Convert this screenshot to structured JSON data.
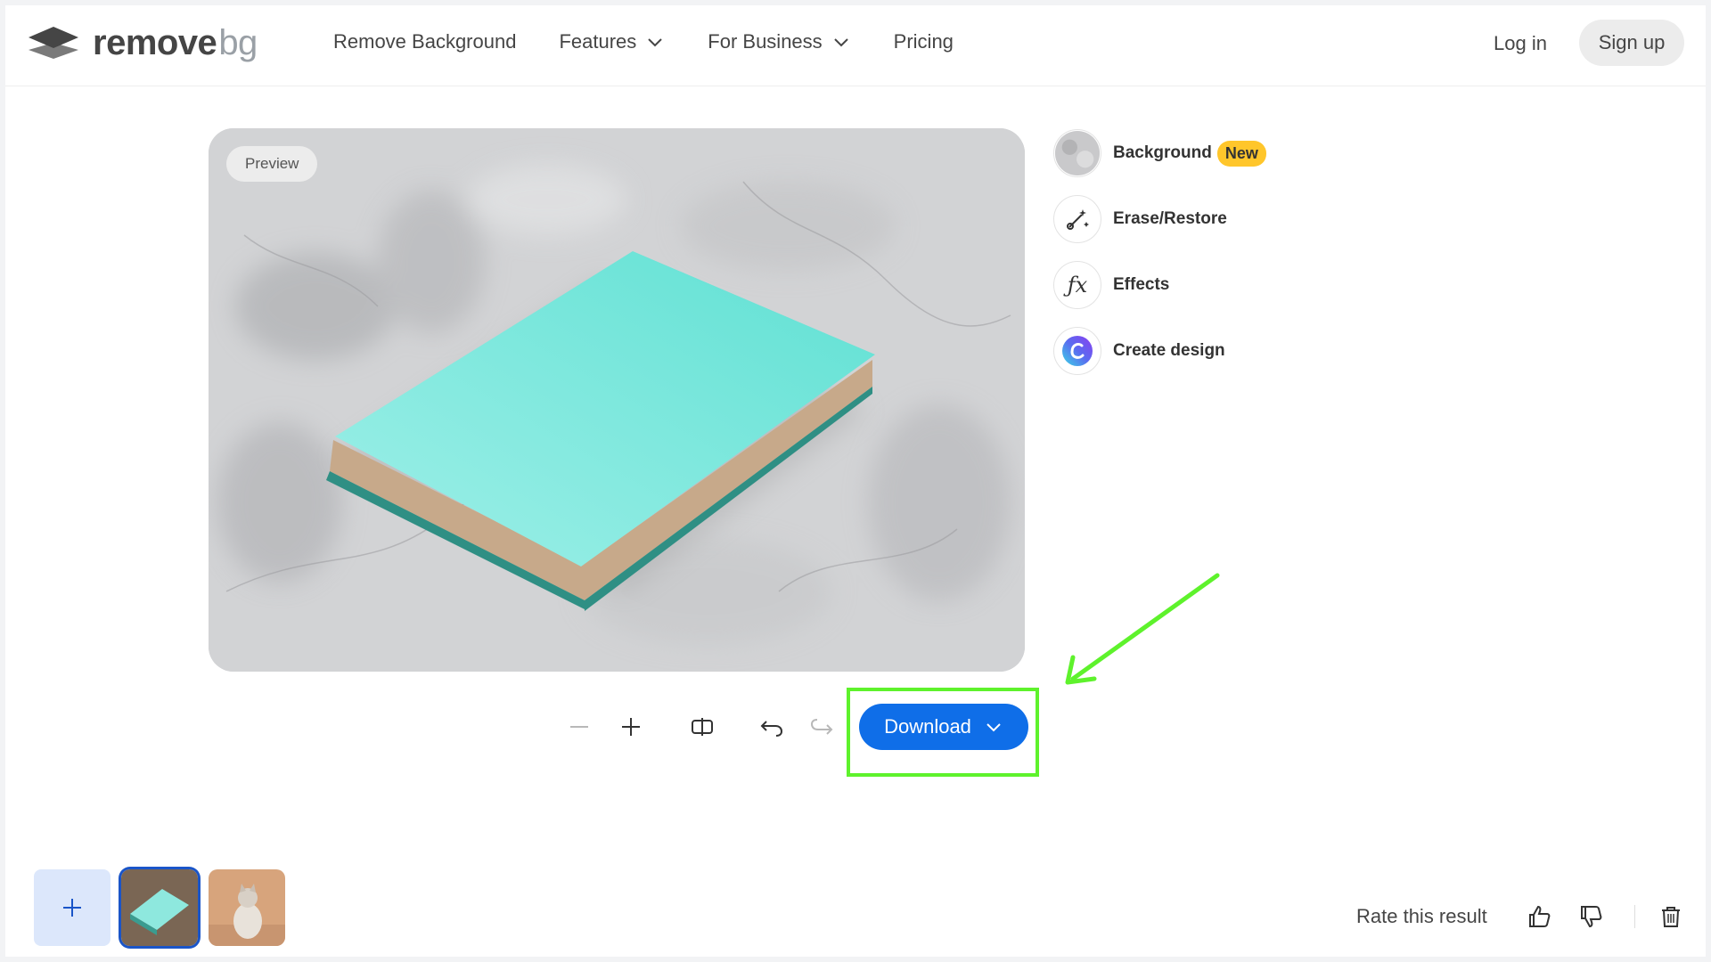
{
  "header": {
    "logo_word": "remove",
    "logo_suffix": "bg",
    "nav": [
      {
        "label": "Remove Background",
        "has_dropdown": false
      },
      {
        "label": "Features",
        "has_dropdown": true
      },
      {
        "label": "For Business",
        "has_dropdown": true
      },
      {
        "label": "Pricing",
        "has_dropdown": false
      }
    ],
    "login_label": "Log in",
    "signup_label": "Sign up"
  },
  "preview": {
    "badge": "Preview"
  },
  "tools": [
    {
      "label": "Background",
      "icon": "background-thumbnail-icon",
      "badge": "New"
    },
    {
      "label": "Erase/Restore",
      "icon": "magic-brush-icon"
    },
    {
      "label": "Effects",
      "icon": "fx-icon"
    },
    {
      "label": "Create design",
      "icon": "canva-logo-icon"
    }
  ],
  "toolbar": {
    "icons": [
      "zoom-out-icon",
      "zoom-in-icon",
      "compare-icon",
      "undo-icon",
      "redo-icon"
    ],
    "download_label": "Download"
  },
  "colors": {
    "accent": "#0f6ee8",
    "highlight": "#5ef22c",
    "new_badge": "#ffc62b",
    "book_cover": "#7fe6dc"
  },
  "bottom": {
    "thumbnails": [
      "book-thumbnail",
      "cat-thumbnail"
    ],
    "rate_label": "Rate this result"
  }
}
